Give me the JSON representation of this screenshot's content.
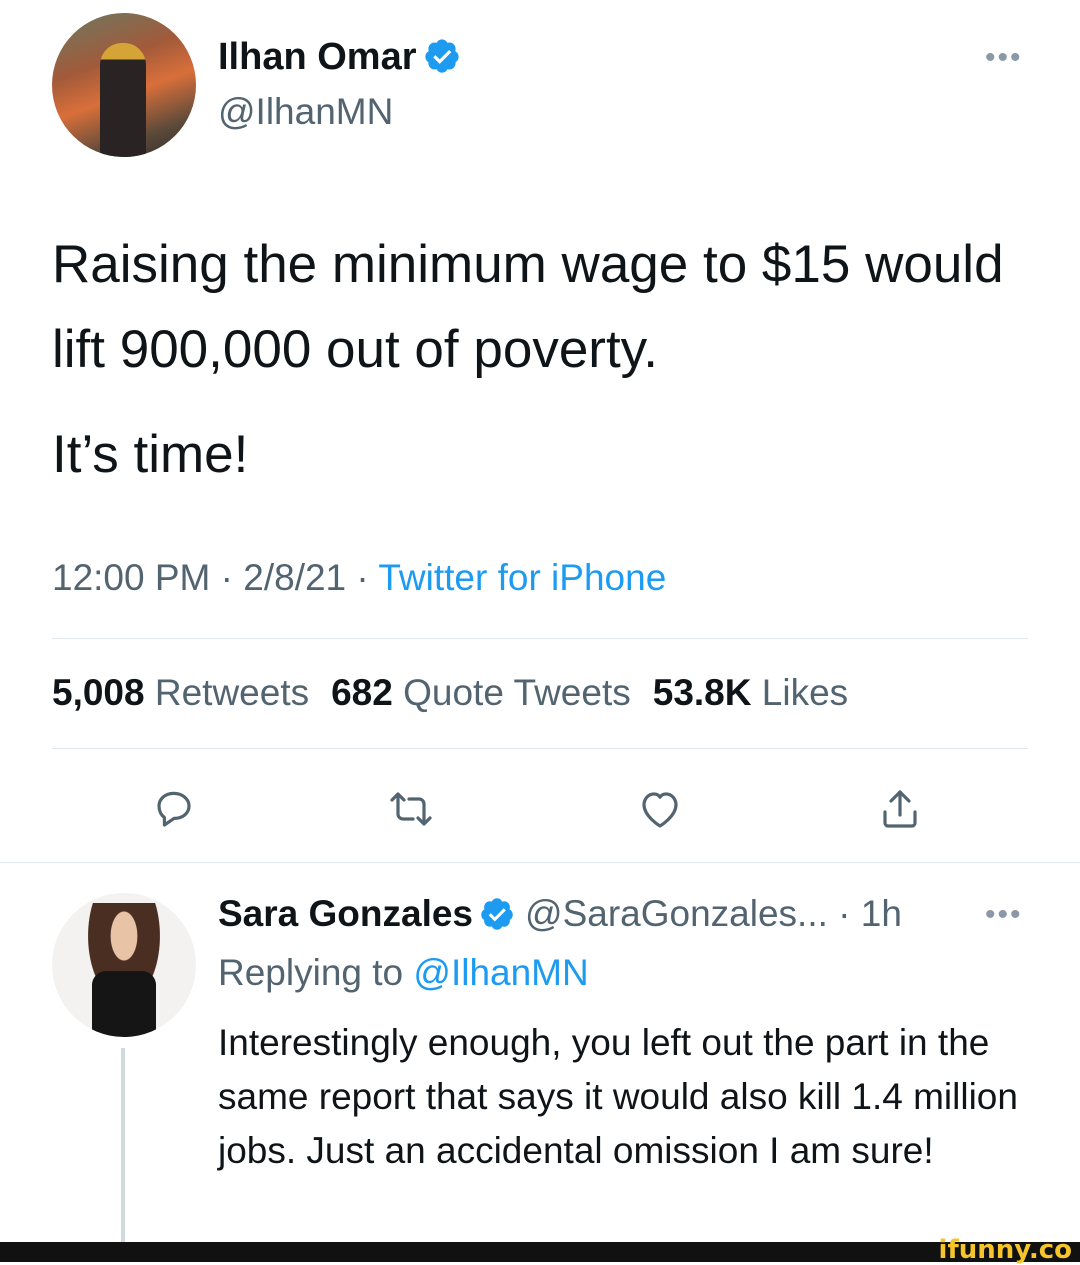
{
  "tweet": {
    "author_name": "Ilhan Omar",
    "author_handle": "@IlhanMN",
    "text_line1": "Raising the minimum wage to $15 would lift 900,000 out of poverty.",
    "text_line2": "It’s time!",
    "time": "12:00 PM",
    "date": "2/8/21",
    "source": "Twitter for iPhone",
    "separator": " · ",
    "retweets_count": "5,008",
    "retweets_label": "Retweets",
    "quotes_count": "682",
    "quotes_label": "Quote Tweets",
    "likes_count": "53.8K",
    "likes_label": "Likes"
  },
  "reply": {
    "author_name": "Sara Gonzales",
    "author_handle": "@SaraGonzales...",
    "time_ago": "1h",
    "replying_prefix": "Replying to",
    "replying_to": "@IlhanMN",
    "text": "Interestingly enough, you left out the part in the same report that says it would also kill 1.4 million jobs. Just an accidental omission I am sure!"
  },
  "more_glyph": "•••",
  "watermark": "ifunny.co",
  "colors": {
    "accent": "#1d9bf0",
    "secondary_text": "#536471",
    "primary_text": "#0f1419"
  },
  "icons": [
    "reply-icon",
    "retweet-icon",
    "like-icon",
    "share-icon",
    "verified-badge-icon",
    "more-options-icon"
  ]
}
